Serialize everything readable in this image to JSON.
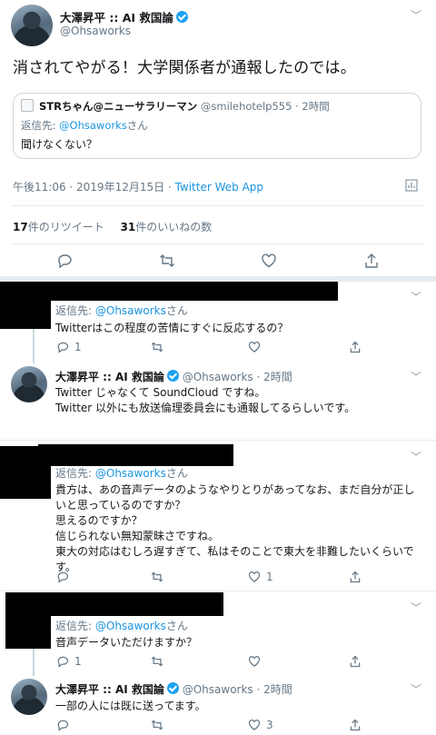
{
  "main_tweet": {
    "name": "大澤昇平 :: AI 救国論",
    "handle": "@Ohsaworks",
    "text": "消されてやがる！大学関係者が通報したのでは。",
    "timestamp": "午後11:06 · 2019年12月15日 ·",
    "client": "Twitter Web App",
    "retweet_count": "17",
    "retweet_label": "件のリツイート",
    "like_count": "31",
    "like_label": "件のいいねの数"
  },
  "quoted": {
    "name": "STRちゃん@ニューサラリーマン",
    "handle": "@smilehotelp555 · 2時間",
    "reply_prefix": "返信先:",
    "reply_to": "@Ohsaworks",
    "reply_suffix": "さん",
    "text": "聞けなくない？"
  },
  "replies": [
    {
      "reply_prefix": "返信先:",
      "reply_to": "@Ohsaworks",
      "reply_suffix": "さん",
      "lines": [
        "Twitterはこの程度の苦情にすぐに反応するの？"
      ],
      "reply_count": "1",
      "retweet_count": "",
      "like_count": ""
    },
    {
      "name": "大澤昇平 :: AI 救国論",
      "handle": "@Ohsaworks · 2時間",
      "lines": [
        "Twitter じゃなくて SoundCloud ですね。",
        "Twitter 以外にも放送倫理委員会にも通報してるらしいです。"
      ]
    },
    {
      "reply_prefix": "返信先:",
      "reply_to": "@Ohsaworks",
      "reply_suffix": "さん",
      "lines": [
        "貴方は、あの音声データのようなやりとりがあってなお、まだ自分が正し",
        "いと思っているのですか？",
        "思えるのですか？",
        "信じられない無知蒙昧さですね。",
        "東大の対応はむしろ遅すぎて、私はそのことで東大を非難したいくらいで",
        "す。"
      ],
      "reply_count": "",
      "retweet_count": "",
      "like_count": "1"
    },
    {
      "reply_prefix": "返信先:",
      "reply_to": "@Ohsaworks",
      "reply_suffix": "さん",
      "lines": [
        "音声データいただけますか？"
      ],
      "reply_count": "1",
      "retweet_count": "",
      "like_count": ""
    },
    {
      "name": "大澤昇平 :: AI 救国論",
      "handle": "@Ohsaworks · 2時間",
      "lines": [
        "一部の人には既に送ってます。"
      ],
      "reply_count": "",
      "retweet_count": "",
      "like_count": "3"
    }
  ]
}
